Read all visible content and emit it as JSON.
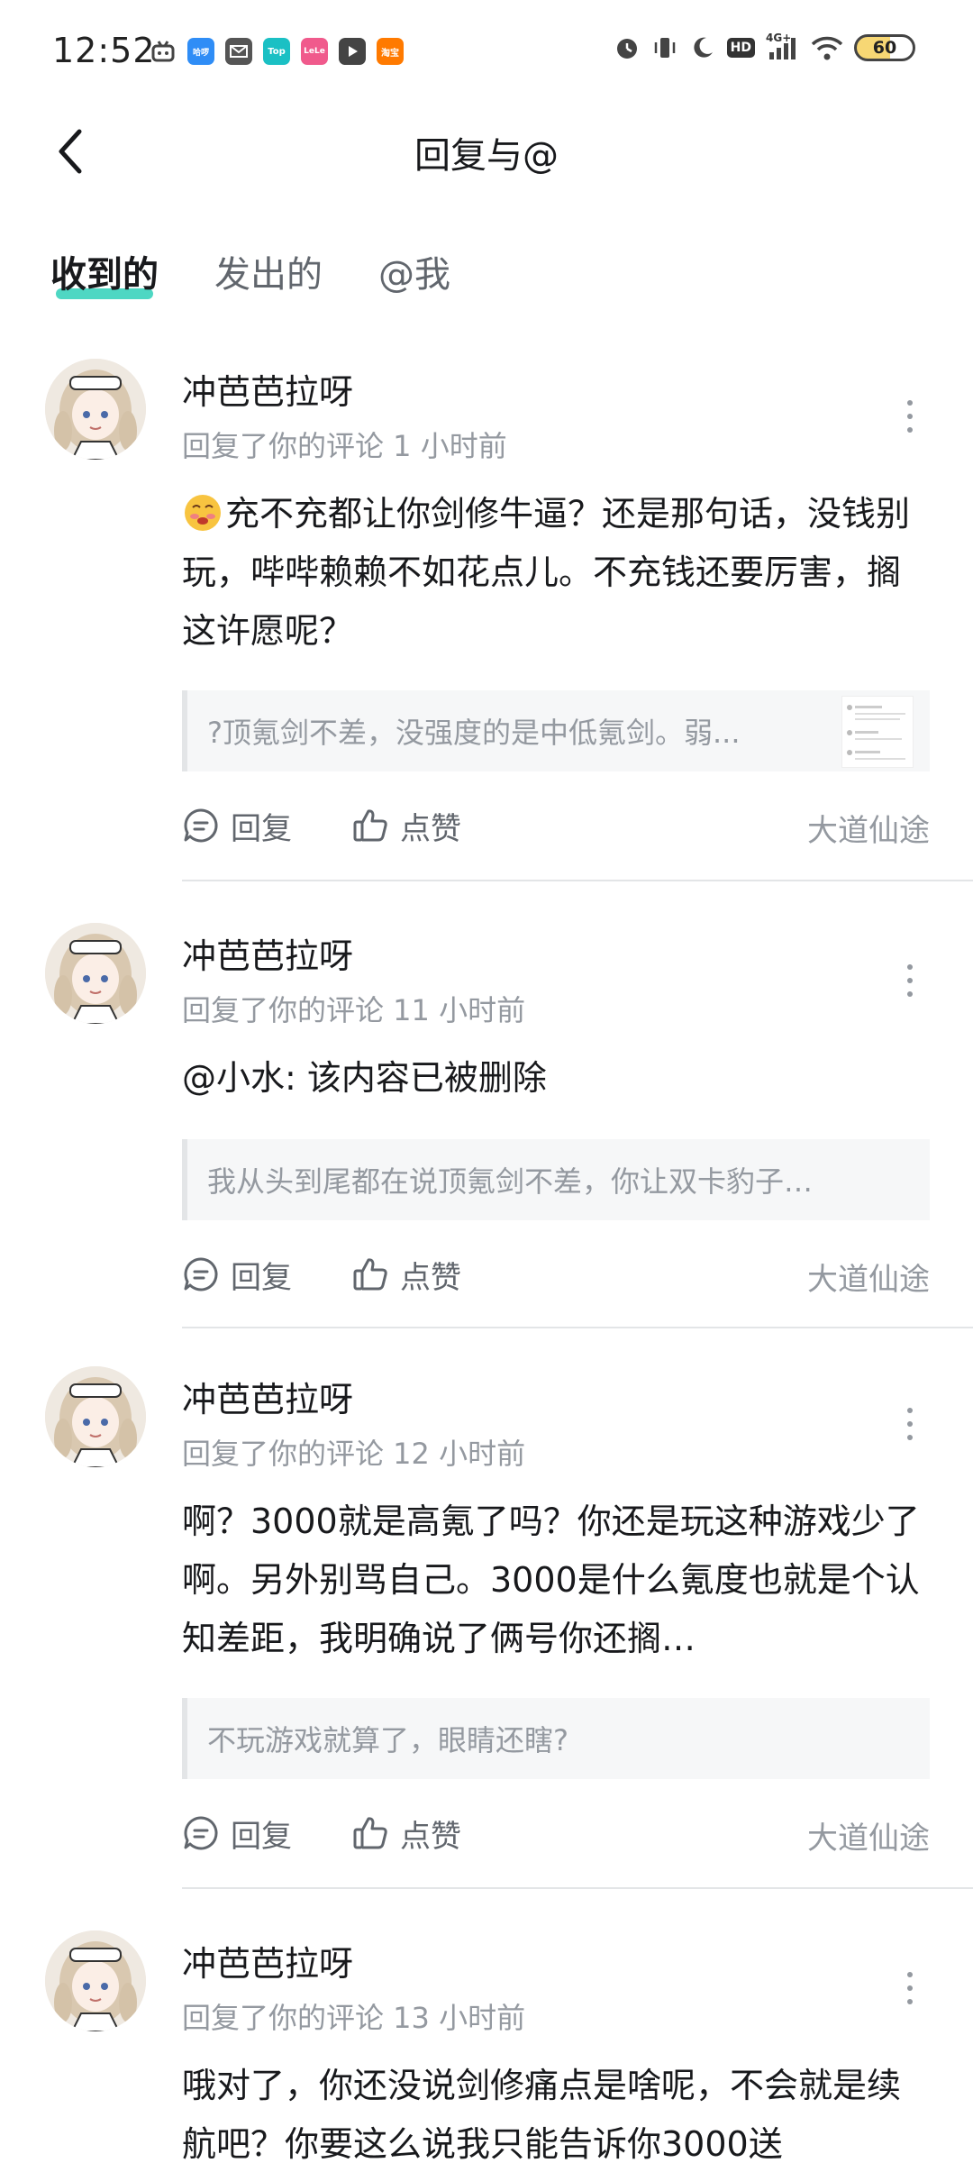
{
  "status_bar": {
    "time": "12:52",
    "battery": "60",
    "network": "4G+",
    "hd": "HD",
    "notification_apps": [
      "bilibili-tv-icon",
      "haluo-app-icon",
      "mail-app-icon",
      "top-app-icon",
      "lele-app-icon",
      "video-app-icon",
      "taobao-app-icon"
    ],
    "app_labels": {
      "haluo": "哈啰",
      "top": "Top",
      "lele": "LeLe",
      "taobao": "淘宝"
    }
  },
  "header": {
    "title": "回复与@",
    "back_icon": "chevron-left-icon"
  },
  "tabs": [
    {
      "label": "收到的",
      "active": true
    },
    {
      "label": "发出的",
      "active": false
    },
    {
      "label": "@我",
      "active": false
    }
  ],
  "actions_labels": {
    "reply": "回复",
    "like": "点赞"
  },
  "items": [
    {
      "user": "冲芭芭拉呀",
      "meta": "回复了你的评论 1 小时前",
      "content": "充不充都让你剑修牛逼？还是那句话，没钱别玩，哔哔赖赖不如花点儿。不充钱还要厉害，搁这许愿呢？",
      "content_emoji": "emoji-blush-icon",
      "quote": "?顶氪剑不差，没强度的是中低氪剑。弱...",
      "quote_has_thumbnail": true,
      "source": "大道仙途"
    },
    {
      "user": "冲芭芭拉呀",
      "meta": "回复了你的评论 11 小时前",
      "content": "@小水: 该内容已被删除",
      "quote": "我从头到尾都在说顶氪剑不差，你让双卡豹子…",
      "quote_has_thumbnail": false,
      "source": "大道仙途"
    },
    {
      "user": "冲芭芭拉呀",
      "meta": "回复了你的评论 12 小时前",
      "content": "啊？3000就是高氪了吗？你还是玩这种游戏少了啊。另外别骂自己。3000是什么氪度也就是个认知差距，我明确说了俩号你还搁…",
      "quote": "不玩游戏就算了，眼睛还瞎?",
      "quote_has_thumbnail": false,
      "source": "大道仙途"
    },
    {
      "user": "冲芭芭拉呀",
      "meta": "回复了你的评论 13 小时前",
      "content": "哦对了，你还没说剑修痛点是啥呢，不会就是续航吧？你要这么说我只能告诉你3000送",
      "quote": "",
      "quote_has_thumbnail": false,
      "source": ""
    }
  ],
  "colors": {
    "accent": "#2fd0b9",
    "primary_text": "#18191c",
    "secondary_text": "#9499a0",
    "action_text": "#61666d",
    "quote_bg": "#f6f7f8",
    "divider": "#e3e5e7"
  }
}
